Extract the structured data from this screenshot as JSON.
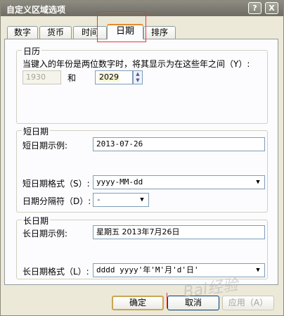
{
  "window": {
    "title": "自定义区域选项",
    "help_glyph": "?",
    "close_glyph": "X"
  },
  "tabs": [
    {
      "label": "数字",
      "active": false
    },
    {
      "label": "货币",
      "active": false
    },
    {
      "label": "时间",
      "active": false
    },
    {
      "label": "日期",
      "active": true
    },
    {
      "label": "排序",
      "active": false
    }
  ],
  "calendar": {
    "title": "日历",
    "description": "当键入的年份是两位数字时，将其显示为在这些年之间（Y）:",
    "year_from": "1930",
    "and_label": "和",
    "year_to": "2029"
  },
  "short_date": {
    "title": "短日期",
    "sample_label": "短日期示例:",
    "sample_value": "2013-07-26",
    "format_label": "短日期格式（S）:",
    "format_value": "yyyy-MM-dd",
    "separator_label": "日期分隔符（D）:",
    "separator_value": "-"
  },
  "long_date": {
    "title": "长日期",
    "sample_label": "长日期示例:",
    "sample_value": "星期五 2013年7月26日",
    "format_label": "长日期格式（L）:",
    "format_value": "dddd yyyy'年'M'月'd'日'"
  },
  "buttons": {
    "ok": "确定",
    "cancel": "取消",
    "apply": "应用（A）"
  },
  "watermark": "Bai经验",
  "colors": {
    "highlight": "#e8353a",
    "tab_accent": "#e68b2c"
  }
}
